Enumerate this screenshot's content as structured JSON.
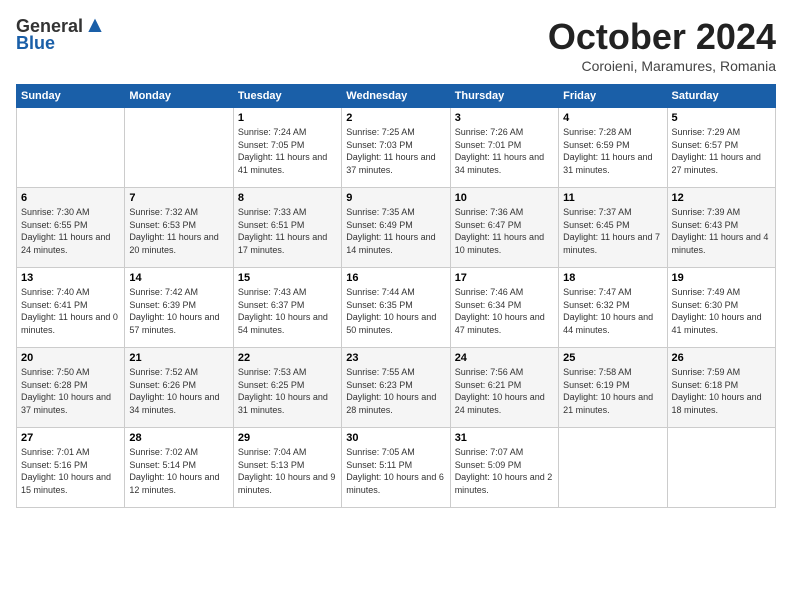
{
  "logo": {
    "general": "General",
    "blue": "Blue"
  },
  "header": {
    "month": "October 2024",
    "location": "Coroieni, Maramures, Romania"
  },
  "weekdays": [
    "Sunday",
    "Monday",
    "Tuesday",
    "Wednesday",
    "Thursday",
    "Friday",
    "Saturday"
  ],
  "weeks": [
    [
      {
        "day": "",
        "info": ""
      },
      {
        "day": "",
        "info": ""
      },
      {
        "day": "1",
        "info": "Sunrise: 7:24 AM\nSunset: 7:05 PM\nDaylight: 11 hours and 41 minutes."
      },
      {
        "day": "2",
        "info": "Sunrise: 7:25 AM\nSunset: 7:03 PM\nDaylight: 11 hours and 37 minutes."
      },
      {
        "day": "3",
        "info": "Sunrise: 7:26 AM\nSunset: 7:01 PM\nDaylight: 11 hours and 34 minutes."
      },
      {
        "day": "4",
        "info": "Sunrise: 7:28 AM\nSunset: 6:59 PM\nDaylight: 11 hours and 31 minutes."
      },
      {
        "day": "5",
        "info": "Sunrise: 7:29 AM\nSunset: 6:57 PM\nDaylight: 11 hours and 27 minutes."
      }
    ],
    [
      {
        "day": "6",
        "info": "Sunrise: 7:30 AM\nSunset: 6:55 PM\nDaylight: 11 hours and 24 minutes."
      },
      {
        "day": "7",
        "info": "Sunrise: 7:32 AM\nSunset: 6:53 PM\nDaylight: 11 hours and 20 minutes."
      },
      {
        "day": "8",
        "info": "Sunrise: 7:33 AM\nSunset: 6:51 PM\nDaylight: 11 hours and 17 minutes."
      },
      {
        "day": "9",
        "info": "Sunrise: 7:35 AM\nSunset: 6:49 PM\nDaylight: 11 hours and 14 minutes."
      },
      {
        "day": "10",
        "info": "Sunrise: 7:36 AM\nSunset: 6:47 PM\nDaylight: 11 hours and 10 minutes."
      },
      {
        "day": "11",
        "info": "Sunrise: 7:37 AM\nSunset: 6:45 PM\nDaylight: 11 hours and 7 minutes."
      },
      {
        "day": "12",
        "info": "Sunrise: 7:39 AM\nSunset: 6:43 PM\nDaylight: 11 hours and 4 minutes."
      }
    ],
    [
      {
        "day": "13",
        "info": "Sunrise: 7:40 AM\nSunset: 6:41 PM\nDaylight: 11 hours and 0 minutes."
      },
      {
        "day": "14",
        "info": "Sunrise: 7:42 AM\nSunset: 6:39 PM\nDaylight: 10 hours and 57 minutes."
      },
      {
        "day": "15",
        "info": "Sunrise: 7:43 AM\nSunset: 6:37 PM\nDaylight: 10 hours and 54 minutes."
      },
      {
        "day": "16",
        "info": "Sunrise: 7:44 AM\nSunset: 6:35 PM\nDaylight: 10 hours and 50 minutes."
      },
      {
        "day": "17",
        "info": "Sunrise: 7:46 AM\nSunset: 6:34 PM\nDaylight: 10 hours and 47 minutes."
      },
      {
        "day": "18",
        "info": "Sunrise: 7:47 AM\nSunset: 6:32 PM\nDaylight: 10 hours and 44 minutes."
      },
      {
        "day": "19",
        "info": "Sunrise: 7:49 AM\nSunset: 6:30 PM\nDaylight: 10 hours and 41 minutes."
      }
    ],
    [
      {
        "day": "20",
        "info": "Sunrise: 7:50 AM\nSunset: 6:28 PM\nDaylight: 10 hours and 37 minutes."
      },
      {
        "day": "21",
        "info": "Sunrise: 7:52 AM\nSunset: 6:26 PM\nDaylight: 10 hours and 34 minutes."
      },
      {
        "day": "22",
        "info": "Sunrise: 7:53 AM\nSunset: 6:25 PM\nDaylight: 10 hours and 31 minutes."
      },
      {
        "day": "23",
        "info": "Sunrise: 7:55 AM\nSunset: 6:23 PM\nDaylight: 10 hours and 28 minutes."
      },
      {
        "day": "24",
        "info": "Sunrise: 7:56 AM\nSunset: 6:21 PM\nDaylight: 10 hours and 24 minutes."
      },
      {
        "day": "25",
        "info": "Sunrise: 7:58 AM\nSunset: 6:19 PM\nDaylight: 10 hours and 21 minutes."
      },
      {
        "day": "26",
        "info": "Sunrise: 7:59 AM\nSunset: 6:18 PM\nDaylight: 10 hours and 18 minutes."
      }
    ],
    [
      {
        "day": "27",
        "info": "Sunrise: 7:01 AM\nSunset: 5:16 PM\nDaylight: 10 hours and 15 minutes."
      },
      {
        "day": "28",
        "info": "Sunrise: 7:02 AM\nSunset: 5:14 PM\nDaylight: 10 hours and 12 minutes."
      },
      {
        "day": "29",
        "info": "Sunrise: 7:04 AM\nSunset: 5:13 PM\nDaylight: 10 hours and 9 minutes."
      },
      {
        "day": "30",
        "info": "Sunrise: 7:05 AM\nSunset: 5:11 PM\nDaylight: 10 hours and 6 minutes."
      },
      {
        "day": "31",
        "info": "Sunrise: 7:07 AM\nSunset: 5:09 PM\nDaylight: 10 hours and 2 minutes."
      },
      {
        "day": "",
        "info": ""
      },
      {
        "day": "",
        "info": ""
      }
    ]
  ]
}
